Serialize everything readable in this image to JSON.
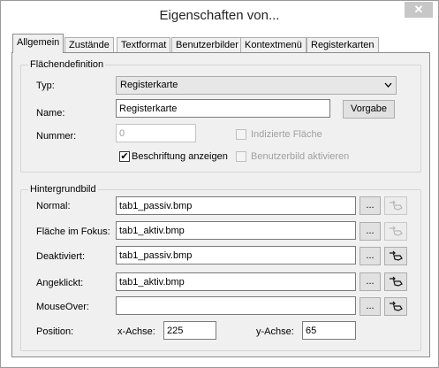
{
  "window": {
    "title": "Eigenschaften von...",
    "close_glyph": "✕"
  },
  "tabs": [
    "Allgemein",
    "Zustände",
    "Textformat",
    "Benutzerbilder",
    "Kontextmenü",
    "Registerkarten"
  ],
  "flaechen": {
    "group_title": "Flächendefinition",
    "typ_label": "Typ:",
    "typ_value": "Registerkarte",
    "name_label": "Name:",
    "name_value": "Registerkarte",
    "vorgabe_label": "Vorgabe",
    "nummer_label": "Nummer:",
    "nummer_value": "0",
    "indizierte_label": "Indizierte Fläche",
    "indizierte_checked": false,
    "beschriftung_label": "Beschriftung anzeigen",
    "beschriftung_checked": true,
    "benutzerbild_label": "Benutzerbild aktivieren",
    "benutzerbild_checked": false
  },
  "hintergrund": {
    "group_title": "Hintergrundbild",
    "rows": [
      {
        "label": "Normal:",
        "value": "tab1_passiv.bmp",
        "browse": "...",
        "pick_enabled": false
      },
      {
        "label": "Fläche im Fokus:",
        "value": "tab1_aktiv.bmp",
        "browse": "...",
        "pick_enabled": false
      },
      {
        "label": "Deaktiviert:",
        "value": "tab1_passiv.bmp",
        "browse": "...",
        "pick_enabled": true
      },
      {
        "label": "Angeklickt:",
        "value": "tab1_aktiv.bmp",
        "browse": "...",
        "pick_enabled": true
      },
      {
        "label": "MouseOver:",
        "value": "",
        "browse": "...",
        "pick_enabled": true
      }
    ],
    "position_label": "Position:",
    "x_label": "x-Achse:",
    "x_value": "225",
    "y_label": "y-Achse:",
    "y_value": "65"
  },
  "icons": {
    "pick": "cursor-pick-icon",
    "checkmark": "✔"
  }
}
